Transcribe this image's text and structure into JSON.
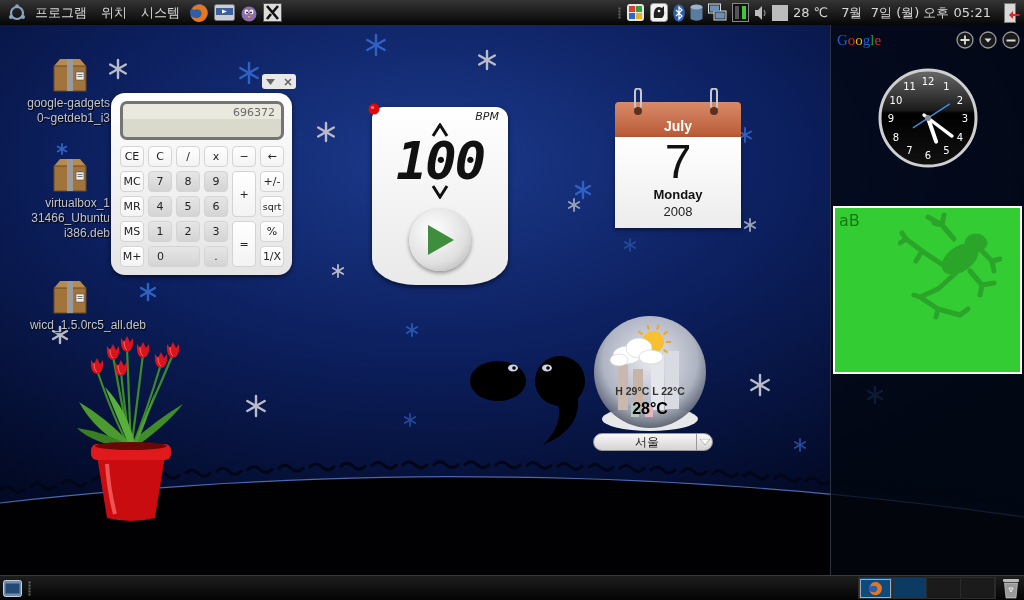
{
  "top_panel": {
    "menus": [
      {
        "label": "프로그램"
      },
      {
        "label": "위치"
      },
      {
        "label": "시스템"
      }
    ],
    "temperature": "28 ℃",
    "clock": "7월  7일 (월) 오후 05:21"
  },
  "desktop_icons": [
    {
      "lines": [
        "google-gadgets",
        "0~getdeb1_i3"
      ]
    },
    {
      "lines": [
        "virtualbox_1",
        "31466_Ubuntu",
        "i386.deb"
      ]
    },
    {
      "lines": [
        "wicd_1.5.0rc5_all.deb"
      ]
    }
  ],
  "calculator": {
    "display": "696372",
    "keys": [
      {
        "label": "CE",
        "kind": "function"
      },
      {
        "label": "C",
        "kind": "function"
      },
      {
        "label": "/",
        "kind": "function"
      },
      {
        "label": "x",
        "kind": "function"
      },
      {
        "label": "−",
        "kind": "function"
      },
      {
        "label": "←",
        "kind": "function"
      },
      {
        "label": "MC",
        "kind": "function"
      },
      {
        "label": "7",
        "kind": "digit"
      },
      {
        "label": "8",
        "kind": "digit"
      },
      {
        "label": "9",
        "kind": "digit"
      },
      {
        "label": "+",
        "kind": "tall"
      },
      {
        "label": "+/-",
        "kind": "function"
      },
      {
        "label": "MR",
        "kind": "function"
      },
      {
        "label": "4",
        "kind": "digit"
      },
      {
        "label": "5",
        "kind": "digit"
      },
      {
        "label": "6",
        "kind": "digit"
      },
      {
        "label": "sqrt",
        "kind": "function"
      },
      {
        "label": "MS",
        "kind": "function"
      },
      {
        "label": "1",
        "kind": "digit"
      },
      {
        "label": "2",
        "kind": "digit"
      },
      {
        "label": "3",
        "kind": "digit"
      },
      {
        "label": "=",
        "kind": "tall"
      },
      {
        "label": "%",
        "kind": "function"
      },
      {
        "label": "M+",
        "kind": "function"
      },
      {
        "label": "0",
        "kind": "wide"
      },
      {
        "label": ".",
        "kind": "digit"
      },
      {
        "label": "1/X",
        "kind": "function"
      }
    ]
  },
  "metronome": {
    "unit": "BPM",
    "tempo": "100",
    "playing": false
  },
  "calendar": {
    "month": "July",
    "day": "7",
    "weekday": "Monday",
    "year": "2008"
  },
  "weather": {
    "high_low": "H 29°C L 22°C",
    "temperature": "28°C",
    "city": "서울"
  },
  "sidebar": {
    "title": "Google",
    "analog_clock": {
      "numerals": [
        "12",
        "1",
        "2",
        "3",
        "4",
        "5",
        "6",
        "7",
        "8",
        "9",
        "10",
        "11"
      ]
    },
    "note_gadget": {
      "text": "aB"
    }
  },
  "bottom_panel": {
    "workspaces": [
      {
        "color": "#0e4a7c",
        "has_window": true
      },
      {
        "color": "#0b3a62",
        "has_window": false
      },
      {
        "color": "#1b1b1b",
        "has_window": false
      },
      {
        "color": "#1b1b1b",
        "has_window": false
      }
    ]
  }
}
